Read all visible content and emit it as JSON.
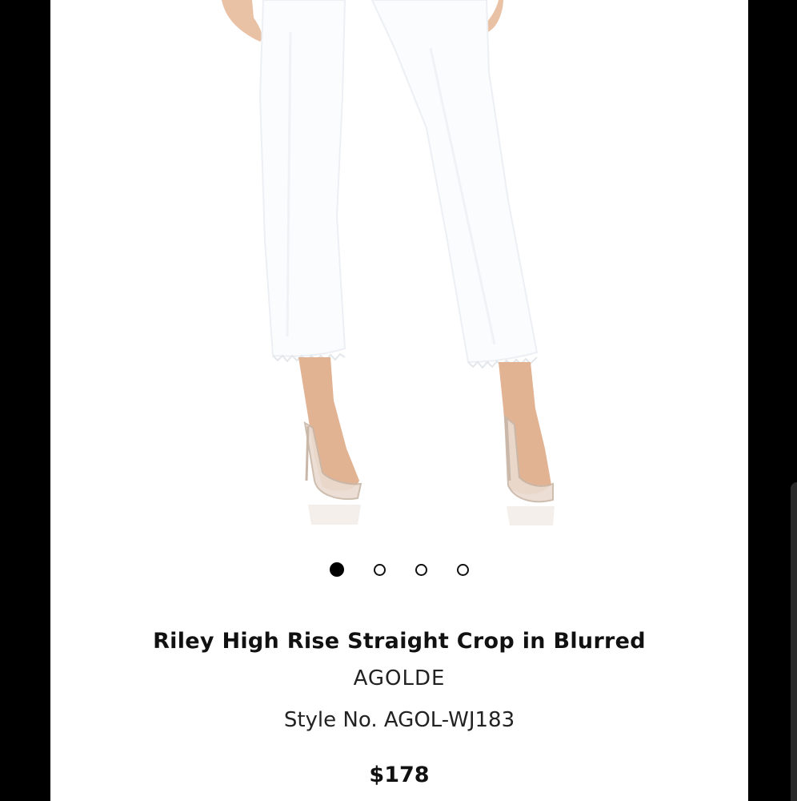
{
  "product": {
    "name": "Riley High Rise Straight Crop in Blurred",
    "brand": "AGOLDE",
    "style_number": "Style No. AGOL-WJ183",
    "price": "$178"
  },
  "carousel": {
    "total": 4,
    "active_index": 1
  }
}
